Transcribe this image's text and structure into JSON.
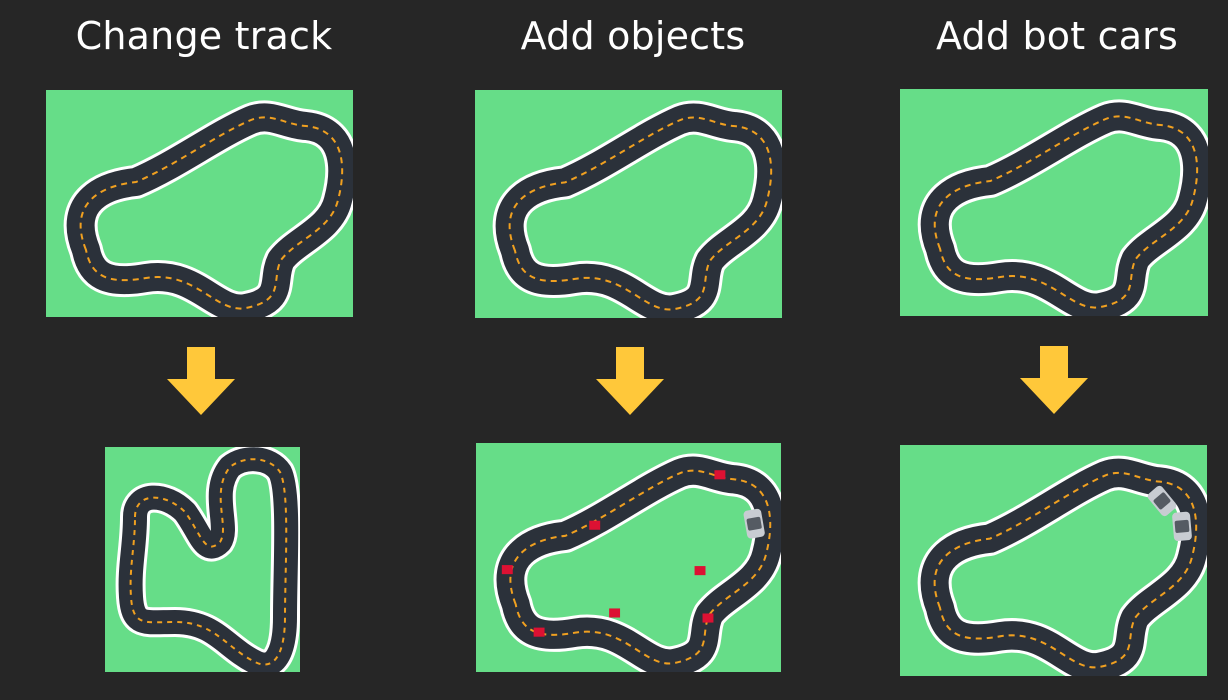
{
  "columns": [
    {
      "title": "Change track"
    },
    {
      "title": "Add objects"
    },
    {
      "title": "Add bot cars"
    }
  ],
  "colors": {
    "background": "#262626",
    "grass": "#66dd88",
    "asphalt": "#2b313a",
    "edge": "#ffffff",
    "lane": "#f0a020",
    "arrow": "#ffc83a",
    "obstacle": "#dd1133",
    "car": "#c8ccd2"
  },
  "icons": [
    "down-arrow-icon",
    "obstacle-box-icon",
    "bot-car-icon"
  ]
}
